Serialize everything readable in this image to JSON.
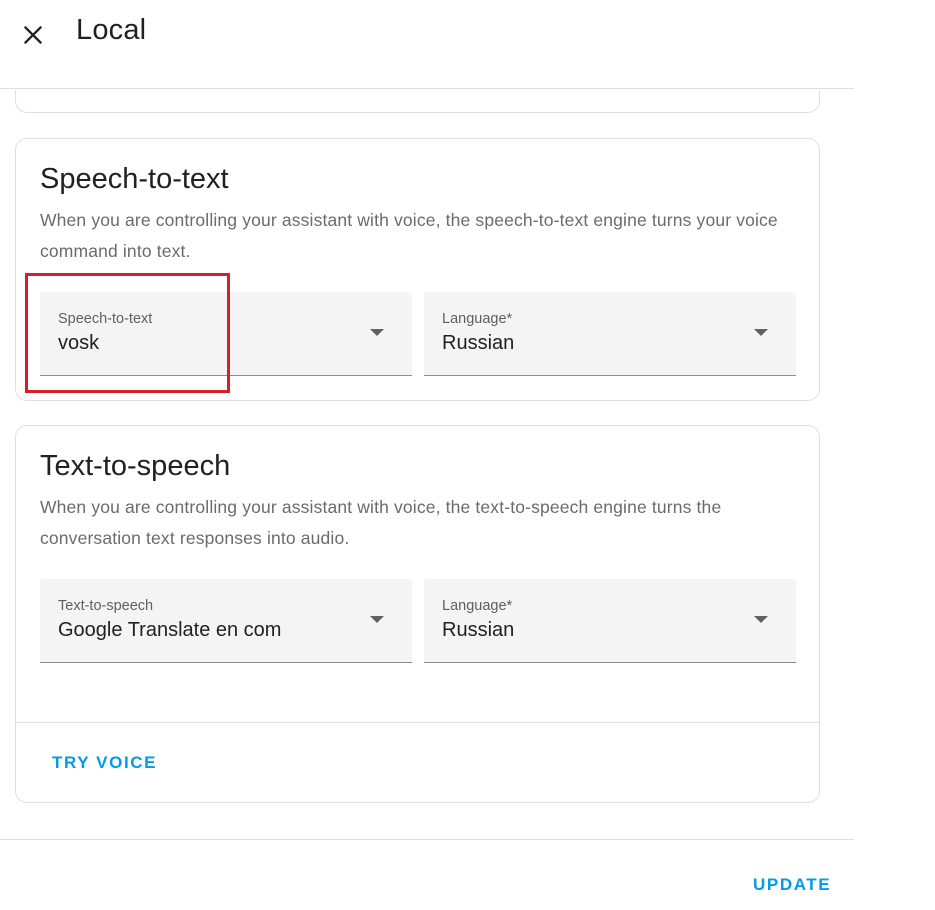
{
  "dialog": {
    "title": "Local",
    "close_icon": "close-icon"
  },
  "stt": {
    "title": "Speech-to-text",
    "description": "When you are controlling your assistant with voice, the speech-to-text engine turns your voice command into text.",
    "engine": {
      "label": "Speech-to-text",
      "value": "vosk"
    },
    "language": {
      "label": "Language*",
      "value": "Russian"
    }
  },
  "tts": {
    "title": "Text-to-speech",
    "description": "When you are controlling your assistant with voice, the text-to-speech engine turns the conversation text responses into audio.",
    "engine": {
      "label": "Text-to-speech",
      "value": "Google Translate en com"
    },
    "language": {
      "label": "Language*",
      "value": "Russian"
    },
    "try_voice_label": "TRY VOICE"
  },
  "footer": {
    "update_label": "UPDATE"
  },
  "colors": {
    "accent": "#039be5",
    "highlight": "#d32029",
    "field_bg": "#f4f4f4"
  }
}
